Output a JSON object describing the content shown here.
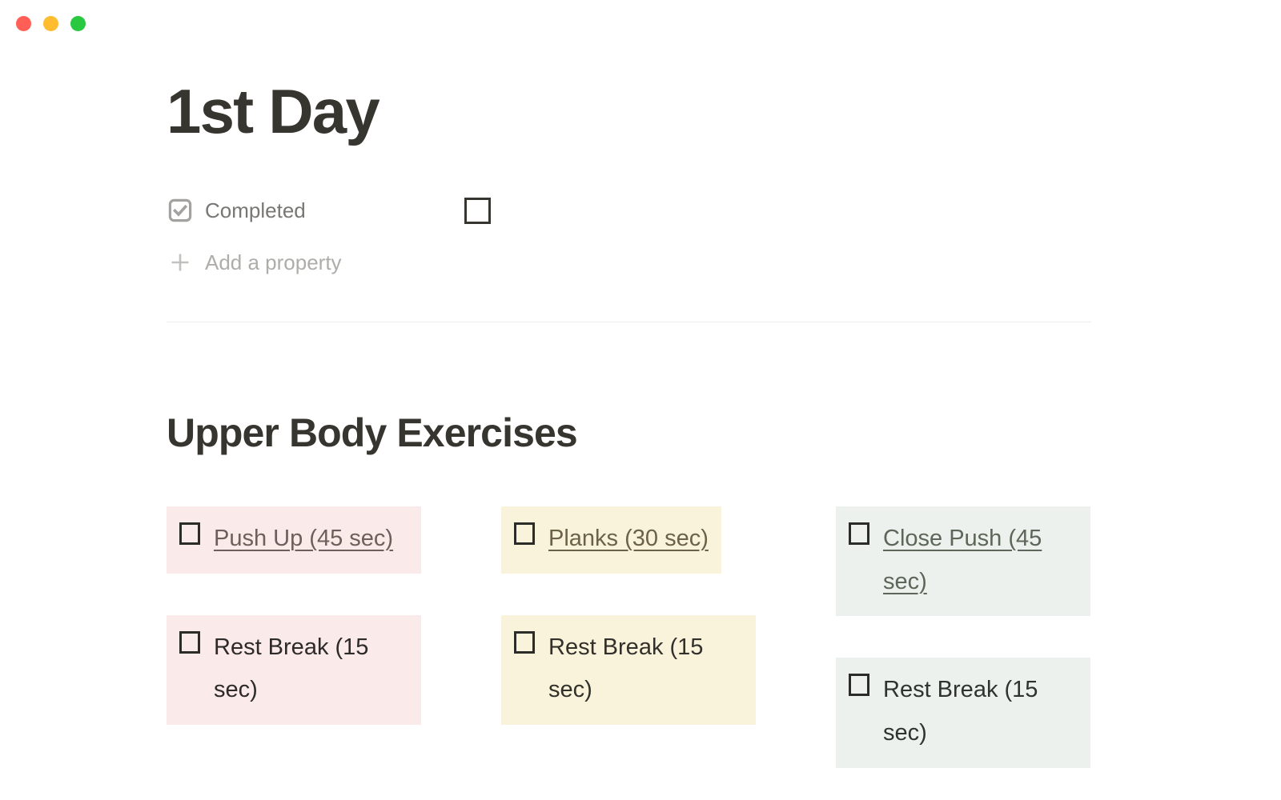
{
  "window": {
    "traffic_lights": [
      {
        "name": "close-button",
        "color": "#FF5F57"
      },
      {
        "name": "minimize-button",
        "color": "#FEBC2E"
      },
      {
        "name": "maximize-button",
        "color": "#28C840"
      }
    ]
  },
  "page": {
    "title": "1st Day",
    "title_color": "#37352F"
  },
  "properties": {
    "rows": [
      {
        "icon": "checkbox-checked-icon",
        "label": "Completed",
        "value_type": "checkbox",
        "checked": false
      }
    ],
    "add_property": {
      "icon": "plus-icon",
      "label": "Add a property"
    }
  },
  "section": {
    "heading": "Upper Body Exercises"
  },
  "columns": [
    {
      "id": "column-pink",
      "bg": "#FAEAEA",
      "link_color": "#6E5F5A",
      "text_color": "#2E2A29",
      "items": [
        {
          "label": "Push Up (45 sec)",
          "checked": false,
          "linked": true,
          "fit": false
        },
        {
          "label": "Rest Break (15 sec)",
          "checked": false,
          "linked": false,
          "fit": false
        }
      ]
    },
    {
      "id": "column-cream",
      "bg": "#FAF3DC",
      "link_color": "#6B6247",
      "text_color": "#32302A",
      "items": [
        {
          "label": "Planks (30 sec)",
          "checked": false,
          "linked": true,
          "fit": true
        },
        {
          "label": "Rest Break (15 sec)",
          "checked": false,
          "linked": false,
          "fit": false
        }
      ]
    },
    {
      "id": "column-sage",
      "bg": "#EDF1ED",
      "link_color": "#5C6659",
      "text_color": "#2F332D",
      "items": [
        {
          "label": "Close Push (45 sec)",
          "checked": false,
          "linked": true,
          "fit": false
        },
        {
          "label": "Rest Break (15 sec)",
          "checked": false,
          "linked": false,
          "fit": false
        }
      ]
    }
  ]
}
